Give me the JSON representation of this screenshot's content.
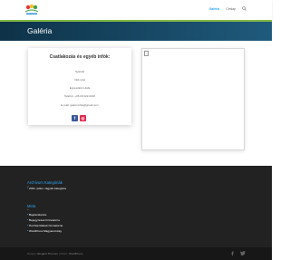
{
  "header": {
    "nav": [
      {
        "label": "Galéria"
      },
      {
        "label": "Címlap"
      }
    ]
  },
  "hero": {
    "title": "Galéria"
  },
  "contact": {
    "title": "Csatlakozás és egyéb infók:",
    "lines": [
      "Nyaraló",
      "Intik utca",
      "Egyesülési Lilafa",
      "Telefon: +36 20 222-2222",
      "E-mail: galeri.infok@gmail.com"
    ],
    "social": [
      "f",
      "◎"
    ]
  },
  "footer": {
    "archive": {
      "title": "Archívum  Kategóriák",
      "items": [
        "2021. július • Egyéb kategória"
      ]
    },
    "meta": {
      "title": "Meta",
      "items": [
        "Bejelentkezés",
        "Bejegyzések hírcsatorna",
        "Hozzászólások hírcsatorna",
        "WordPress Magyarország"
      ]
    }
  },
  "credits": {
    "designed_prefix": "Design: ",
    "designed_name": "Elegant Themes",
    "separator": " | Motor: ",
    "powered_name": "WordPress"
  },
  "colors": {
    "accent": "#2ea3f2",
    "hero": "#1a4a66",
    "hero_accent": "#8bc34a",
    "footer": "#222222"
  }
}
